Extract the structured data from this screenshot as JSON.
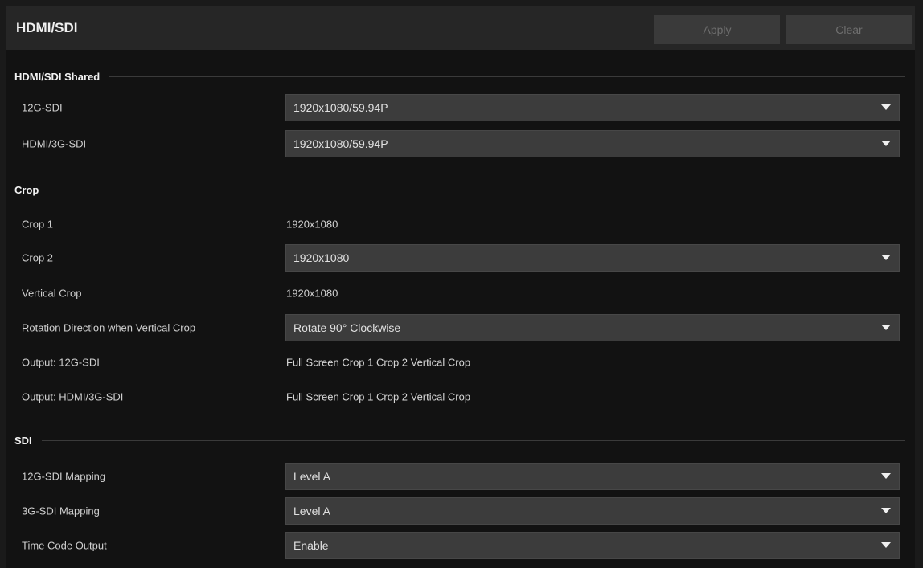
{
  "header": {
    "title": "HDMI/SDI",
    "apply_label": "Apply",
    "clear_label": "Clear"
  },
  "sections": {
    "shared": {
      "title": "HDMI/SDI Shared",
      "sdi12g_label": "12G-SDI",
      "sdi12g_value": "1920x1080/59.94P",
      "hdmi3g_label": "HDMI/3G-SDI",
      "hdmi3g_value": "1920x1080/59.94P"
    },
    "crop": {
      "title": "Crop",
      "crop1_label": "Crop 1",
      "crop1_value": "1920x1080",
      "crop2_label": "Crop 2",
      "crop2_value": "1920x1080",
      "vertical_label": "Vertical Crop",
      "vertical_value": "1920x1080",
      "rotation_label": "Rotation Direction when Vertical Crop",
      "rotation_value": "Rotate 90° Clockwise",
      "out12g_label": "Output: 12G-SDI",
      "out12g_value": "Full Screen Crop 1 Crop 2 Vertical Crop",
      "outhdmi_label": "Output: HDMI/3G-SDI",
      "outhdmi_value": "Full Screen Crop 1 Crop 2 Vertical Crop"
    },
    "sdi": {
      "title": "SDI",
      "map12g_label": "12G-SDI Mapping",
      "map12g_value": "Level A",
      "map3g_label": "3G-SDI Mapping",
      "map3g_value": "Level A",
      "tc_label": "Time Code Output",
      "tc_value": "Enable"
    }
  },
  "colors": {
    "panel_bg": "#121212",
    "header_bg": "#262626",
    "select_bg": "#3c3c3c",
    "disabled_button_bg": "#3a3a3a"
  }
}
